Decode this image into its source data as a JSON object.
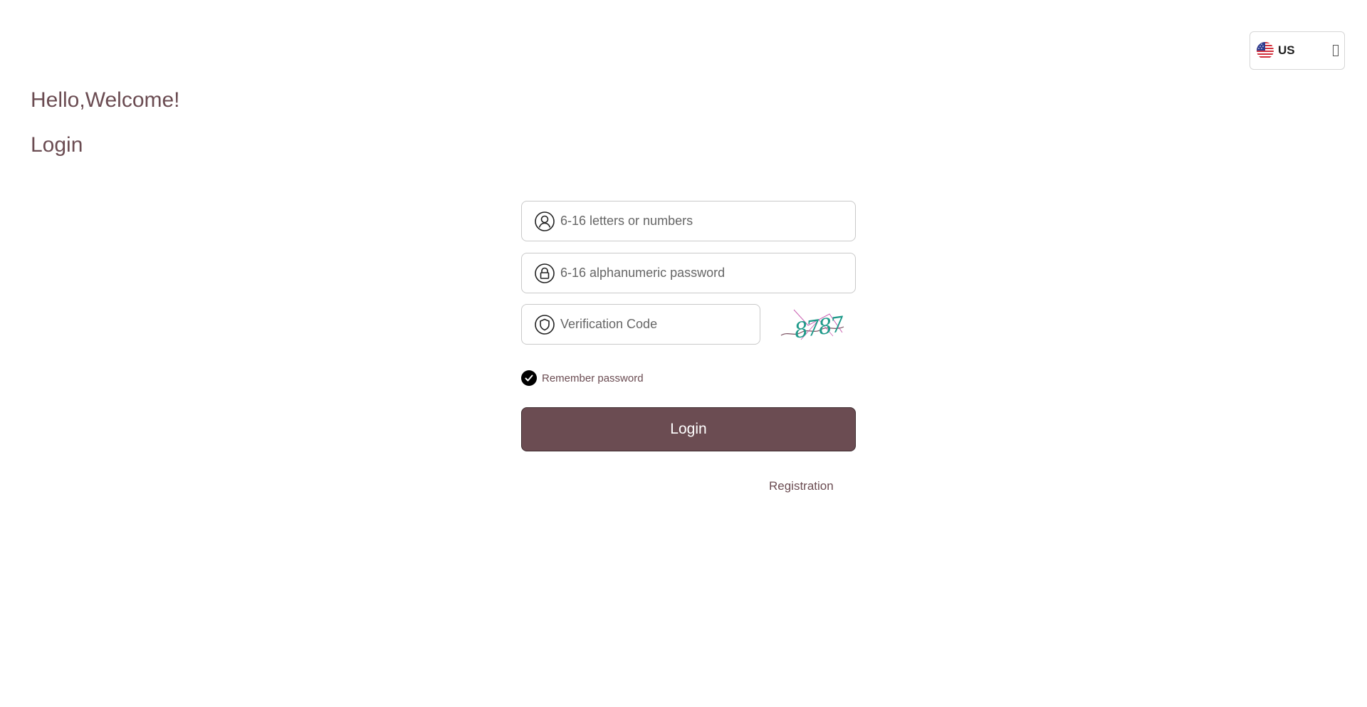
{
  "language": {
    "code": "US",
    "flag_icon": "us-flag-icon",
    "chevron_icon": "chevron-down-icon"
  },
  "header": {
    "welcome": "Hello,Welcome!",
    "title": "Login"
  },
  "form": {
    "username_placeholder": "6-16 letters or numbers",
    "password_placeholder": "6-16 alphanumeric password",
    "code_placeholder": "Verification Code",
    "captcha_text": "8787",
    "remember_label": "Remember password",
    "remember_checked": true,
    "login_label": "Login",
    "register_label": "Registration"
  },
  "colors": {
    "accent": "#6b4c52",
    "button_text": "#ffffff",
    "captcha": "#1f9a8a"
  }
}
